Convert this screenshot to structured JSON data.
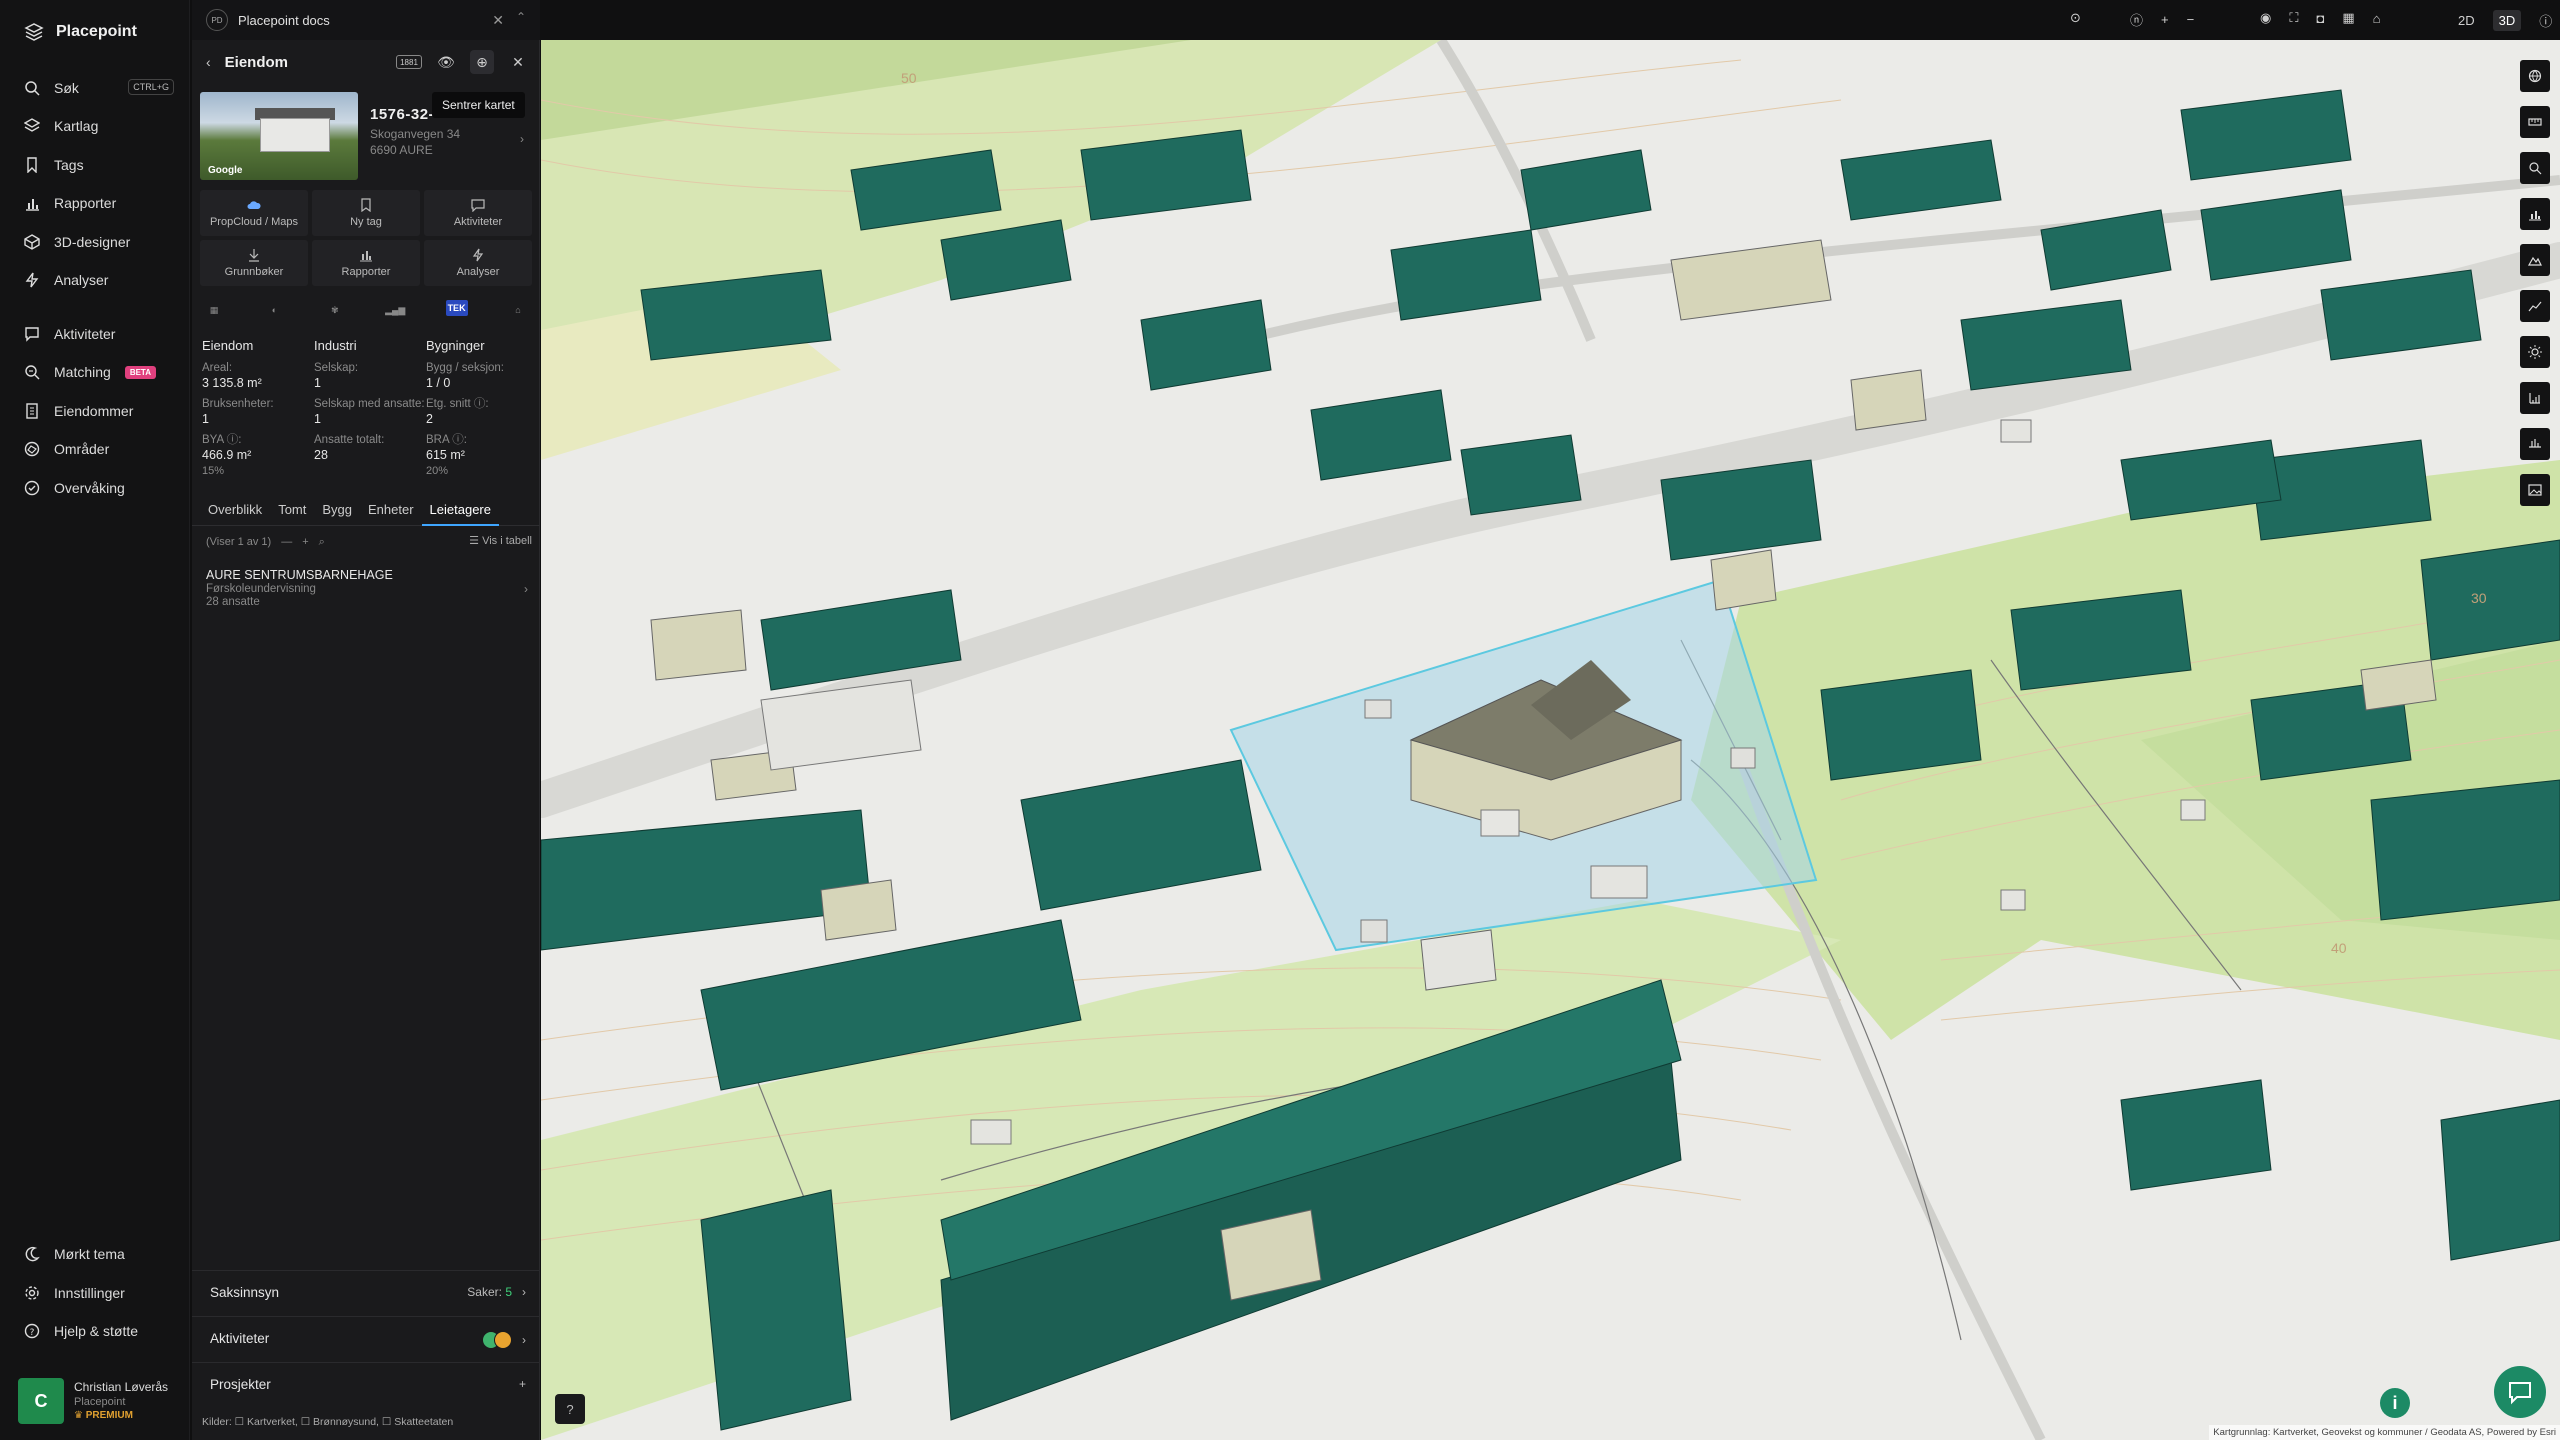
{
  "app": {
    "name": "Placepoint"
  },
  "nav": {
    "items": [
      {
        "label": "Søk",
        "shortcut": "CTRL+G"
      },
      {
        "label": "Kartlag"
      },
      {
        "label": "Tags"
      },
      {
        "label": "Rapporter"
      },
      {
        "label": "3D-designer"
      },
      {
        "label": "Analyser"
      },
      {
        "label": "Aktiviteter"
      },
      {
        "label": "Matching",
        "badge": "BETA"
      },
      {
        "label": "Eiendommer"
      },
      {
        "label": "Områder"
      },
      {
        "label": "Overvåking"
      }
    ],
    "bottom": [
      {
        "label": "Mørkt tema"
      },
      {
        "label": "Innstillinger"
      },
      {
        "label": "Hjelp & støtte"
      }
    ],
    "user": {
      "initial": "C",
      "name": "Christian Løverås",
      "org": "Placepoint",
      "plan": "PREMIUM"
    }
  },
  "panel": {
    "doc_tab": {
      "badge": "PD",
      "title": "Placepoint docs"
    },
    "header": {
      "title": "Eiendom",
      "tag_1881": "1881"
    },
    "tooltip": "Sentrer kartet",
    "photo_label": "Google",
    "property": {
      "id": "1576-32-",
      "street": "Skoganvegen 34",
      "postal": "6690 AURE"
    },
    "actions": [
      {
        "label": "PropCloud / Maps"
      },
      {
        "label": "Ny tag"
      },
      {
        "label": "Aktiviteter"
      },
      {
        "label": "Grunnbøker"
      },
      {
        "label": "Rapporter"
      },
      {
        "label": "Analyser"
      }
    ],
    "source_tek": "TEK",
    "stats": {
      "eiendom": {
        "heading": "Eiendom",
        "areal_label": "Areal:",
        "areal_value": "3 135.8 m²",
        "bruks_label": "Bruksenheter:",
        "bruks_value": "1",
        "bya_label": "BYA ⓘ:",
        "bya_value": "466.9 m²",
        "bya_pct": "15%"
      },
      "industri": {
        "heading": "Industri",
        "selskap_label": "Selskap:",
        "selskap_value": "1",
        "selskap_ans_label": "Selskap med ansatte:",
        "selskap_ans_value": "1",
        "ansatte_label": "Ansatte totalt:",
        "ansatte_value": "28"
      },
      "bygninger": {
        "heading": "Bygninger",
        "bygg_label": "Bygg / seksjon:",
        "bygg_value": "1 / 0",
        "etg_label": "Etg. snitt ⓘ:",
        "etg_value": "2",
        "bra_label": "BRA ⓘ:",
        "bra_value": "615 m²",
        "bra_pct": "20%"
      }
    },
    "tabs": [
      "Overblikk",
      "Tomt",
      "Bygg",
      "Enheter",
      "Leietagere"
    ],
    "active_tab": "Leietagere",
    "list": {
      "count": "(Viser 1 av 1)",
      "table_link": "Vis i tabell"
    },
    "tenant": {
      "name": "AURE SENTRUMSBARNEHAGE",
      "category": "Førskoleundervisning",
      "employees": "28 ansatte"
    },
    "sections": [
      {
        "label": "Saksinnsyn",
        "right_label": "Saker:",
        "right_value": "5"
      },
      {
        "label": "Aktiviteter"
      },
      {
        "label": "Prosjekter"
      }
    ],
    "sources": "Kilder: ☐ Kartverket, ☐ Brønnøysund, ☐ Skatteetaten"
  },
  "topbar": {
    "dim2": "2D",
    "dim3": "3D"
  },
  "map": {
    "contour_labels": [
      "50",
      "40",
      "30"
    ],
    "attribution": "Kartgrunnlag: Kartverket, Geovekst og kommuner / Geodata AS, Powered by Esri",
    "colors": {
      "building": "#1f6b5e",
      "building_dark": "#1a5a4f",
      "highlight": "#5cc9e0",
      "ground": "#ebebe8",
      "green": "#cfe3a8",
      "accent": "#1c8a65"
    }
  }
}
